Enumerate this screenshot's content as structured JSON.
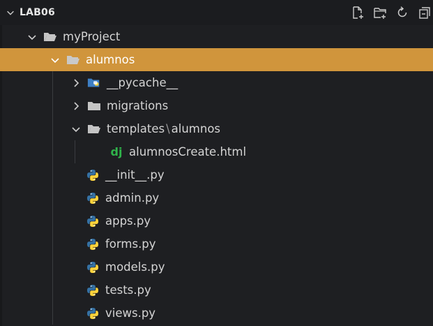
{
  "header": {
    "title": "LAB06",
    "actions": [
      "new-file-icon",
      "new-folder-icon",
      "refresh-icon",
      "collapse-all-icon"
    ]
  },
  "colors": {
    "selection": "#d0953c",
    "python_blue": "#3572a5",
    "python_yellow": "#ffd43b",
    "django_green": "#2fb34a",
    "folder": "#c5c5c5"
  },
  "tree": [
    {
      "label": "myProject",
      "type": "folder",
      "expanded": true
    },
    {
      "label": "alumnos",
      "type": "folder",
      "expanded": true,
      "selected": true
    },
    {
      "label": "__pycache__",
      "type": "pycache-folder",
      "expanded": false
    },
    {
      "label": "migrations",
      "type": "folder",
      "expanded": false
    },
    {
      "label_a": "templates",
      "label_sep": "\\",
      "label_b": "alumnos",
      "type": "folder",
      "expanded": true
    },
    {
      "label": "alumnosCreate.html",
      "type": "django-file",
      "icon_text": "dj"
    },
    {
      "label": "__init__.py",
      "type": "python-file"
    },
    {
      "label": "admin.py",
      "type": "python-file"
    },
    {
      "label": "apps.py",
      "type": "python-file"
    },
    {
      "label": "forms.py",
      "type": "python-file"
    },
    {
      "label": "models.py",
      "type": "python-file"
    },
    {
      "label": "tests.py",
      "type": "python-file"
    },
    {
      "label": "views.py",
      "type": "python-file"
    }
  ]
}
